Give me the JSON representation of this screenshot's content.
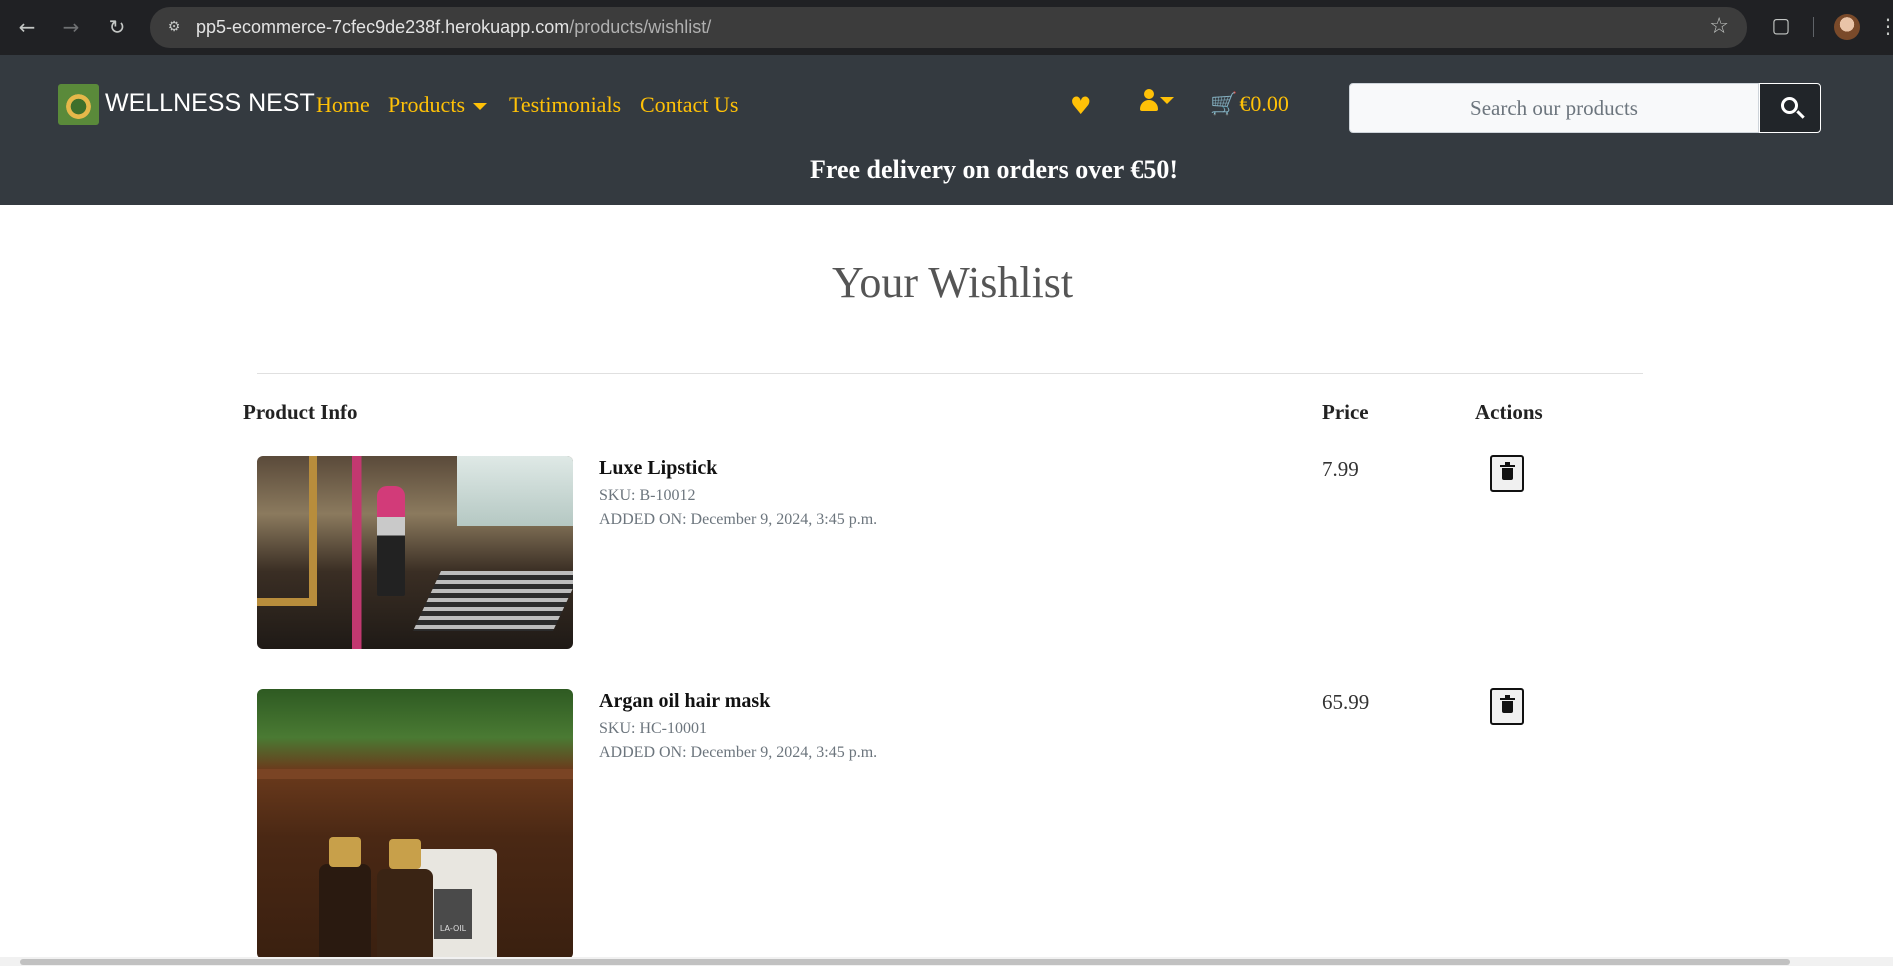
{
  "browser": {
    "url_host": "pp5-ecommerce-7cfec9de238f.herokuapp.com",
    "url_path": "/products/wishlist/"
  },
  "header": {
    "brand": "WELLNESS NEST",
    "nav": {
      "home": "Home",
      "products": "Products",
      "testimonials": "Testimonials",
      "contact": "Contact Us"
    },
    "cart_total": "€0.00",
    "search_placeholder": "Search our products",
    "banner": "Free delivery on orders over €50!",
    "accent_color": "#ffc107",
    "bg_color": "#343a40"
  },
  "main": {
    "title": "Your Wishlist",
    "columns": {
      "info": "Product Info",
      "price": "Price",
      "actions": "Actions"
    },
    "items": [
      {
        "name": "Luxe Lipstick",
        "sku": "SKU: B-10012",
        "added": "ADDED ON: December 9, 2024, 3:45 p.m.",
        "price": "7.99"
      },
      {
        "name": "Argan oil hair mask",
        "sku": "SKU: HC-10001",
        "added": "ADDED ON: December 9, 2024, 3:45 p.m.",
        "price": "65.99",
        "image_label": "LA-OIL"
      }
    ]
  }
}
